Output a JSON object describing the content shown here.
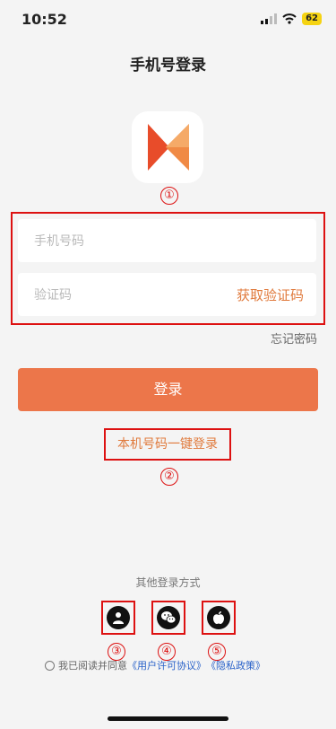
{
  "status": {
    "time": "10:52",
    "battery": "62"
  },
  "header": {
    "title": "手机号登录"
  },
  "annotations": [
    "①",
    "②",
    "③",
    "④",
    "⑤"
  ],
  "form": {
    "phone_placeholder": "手机号码",
    "code_placeholder": "验证码",
    "get_code": "获取验证码",
    "forgot": "忘记密码",
    "login": "登录",
    "one_click": "本机号码一键登录"
  },
  "other": {
    "title": "其他登录方式"
  },
  "agreement": {
    "prefix": "我已阅读并同意",
    "user_agreement": "《用户许可协议》",
    "privacy": "《隐私政策》"
  },
  "colors": {
    "accent": "#ec764a",
    "link": "#2a62c9",
    "annotation": "#dd1111"
  }
}
